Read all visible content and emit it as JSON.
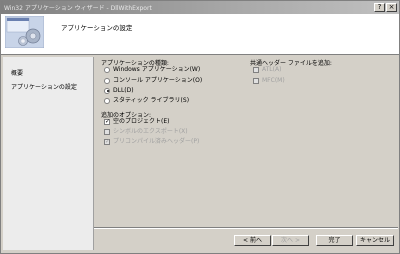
{
  "window": {
    "title": "Win32 アプリケーション ウィザード - DllWithExport"
  },
  "titlebar_buttons": {
    "help": "?",
    "close": "×"
  },
  "header": {
    "title": "アプリケーションの設定"
  },
  "sidebar": {
    "items": [
      {
        "label": "概要"
      },
      {
        "label": "アプリケーションの設定"
      }
    ]
  },
  "app_type": {
    "title": "アプリケーションの種類:",
    "options": [
      {
        "label": "Windows アプリケーション(W)",
        "selected": false
      },
      {
        "label": "コンソール アプリケーション(O)",
        "selected": false
      },
      {
        "label": "DLL(D)",
        "selected": true
      },
      {
        "label": "スタティック ライブラリ(S)",
        "selected": false
      }
    ]
  },
  "additional": {
    "title": "追加のオプション:",
    "options": [
      {
        "label": "空のプロジェクト(E)",
        "checked": true,
        "enabled": true
      },
      {
        "label": "シンボルのエクスポート(X)",
        "checked": false,
        "enabled": false
      },
      {
        "label": "プリコンパイル済みヘッダー(P)",
        "checked": true,
        "enabled": false
      }
    ]
  },
  "common_headers": {
    "title": "共通ヘッダー ファイルを追加:",
    "options": [
      {
        "label": "ATL(A)",
        "checked": false,
        "enabled": false
      },
      {
        "label": "MFC(M)",
        "checked": false,
        "enabled": false
      }
    ]
  },
  "buttons": {
    "back": "< 前へ",
    "next": "次へ >",
    "finish": "完了",
    "cancel": "キャンセル"
  }
}
